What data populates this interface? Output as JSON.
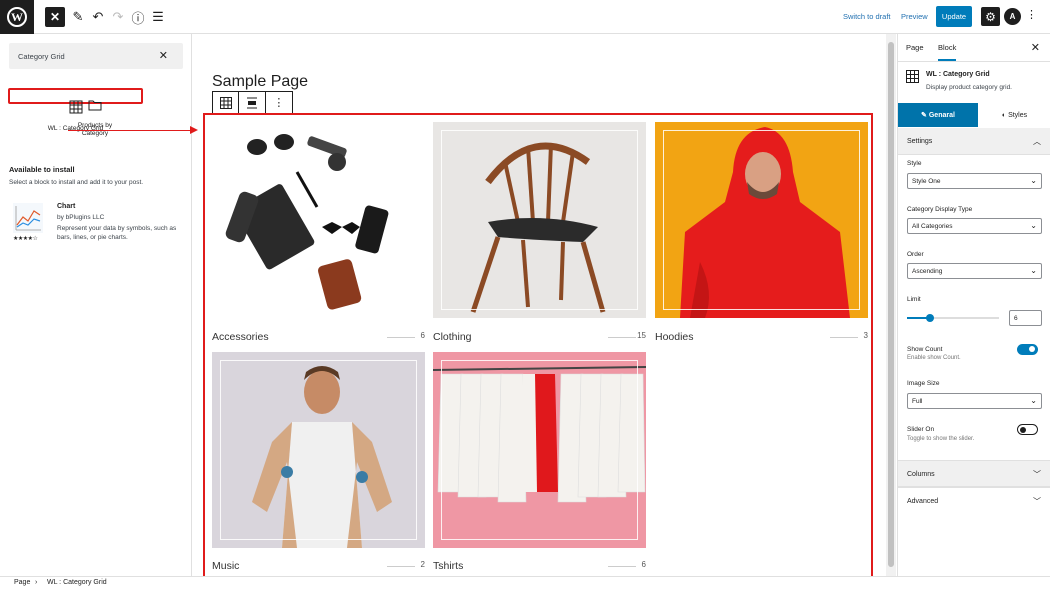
{
  "topbar": {
    "switch_to_draft": "Switch to draft",
    "preview": "Preview",
    "update": "Update"
  },
  "inserter": {
    "search_value": "Category Grid",
    "blocks": [
      {
        "label": "WL : Category Grid",
        "icon": "table-icon"
      },
      {
        "label": "Products by Category",
        "icon": "folder-icon"
      }
    ],
    "available_title": "Available to install",
    "available_sub": "Select a block to install and add it to your post.",
    "chart_block": {
      "name": "Chart",
      "by": "by bPlugins LLC",
      "description": "Represent your data by symbols, such as bars, lines, or pie charts.",
      "rating": 4.5
    }
  },
  "canvas": {
    "page_title": "Sample Page",
    "categories": [
      {
        "name": "Accessories",
        "count": "6"
      },
      {
        "name": "Clothing",
        "count": "15"
      },
      {
        "name": "Hoodies",
        "count": "3"
      },
      {
        "name": "Music",
        "count": "2"
      },
      {
        "name": "Tshirts",
        "count": "6"
      }
    ]
  },
  "sidebar": {
    "tab_page": "Page",
    "tab_block": "Block",
    "block_title": "WL : Category Grid",
    "block_desc": "Display product category grid.",
    "tab_general": "Genaral",
    "tab_styles": "Styles",
    "settings_title": "Settings",
    "style_label": "Style",
    "style_value": "Style One",
    "display_type_label": "Category Display Type",
    "display_type_value": "All Categories",
    "order_label": "Order",
    "order_value": "Ascending",
    "limit_label": "Limit",
    "limit_value": "6",
    "limit_slider_fraction": 0.25,
    "show_count_label": "Show Count",
    "show_count_help": "Enable show Count.",
    "show_count_on": true,
    "image_size_label": "Image Size",
    "image_size_value": "Full",
    "slider_label": "Slider On",
    "slider_help": "Toggle to show the slider.",
    "slider_on": false,
    "columns_title": "Columns",
    "advanced_title": "Advanced"
  },
  "breadcrumb": {
    "root": "Page",
    "current": "WL : Category Grid"
  },
  "colors": {
    "accent": "#007cba",
    "highlight": "#e01b1b"
  }
}
